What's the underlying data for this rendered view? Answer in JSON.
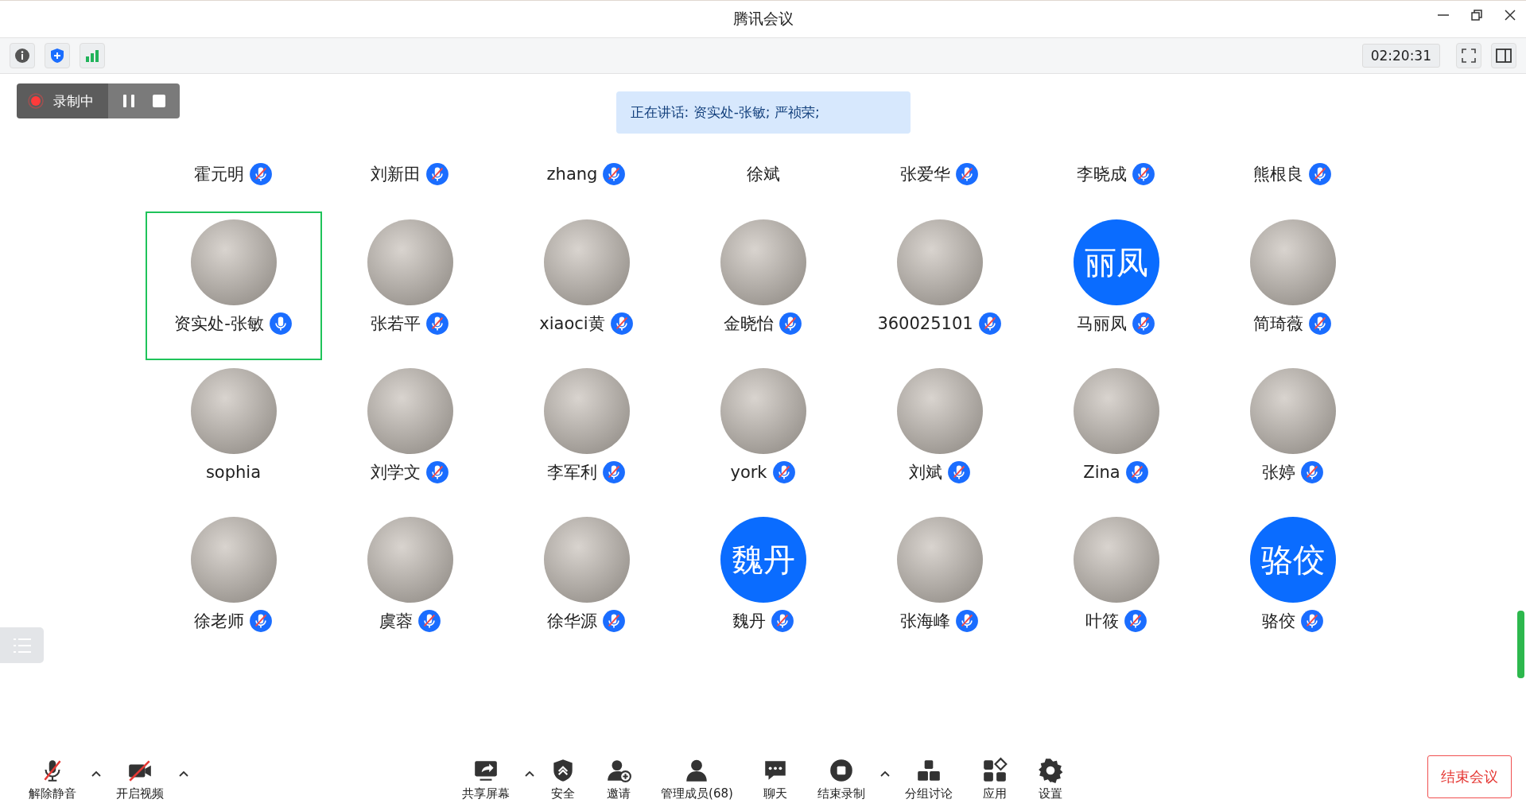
{
  "window": {
    "title": "腾讯会议"
  },
  "toolbar": {
    "timer": "02:20:31"
  },
  "recording": {
    "label": "录制中"
  },
  "speaking_banner": "正在讲话: 资实处-张敏; 严祯荣;",
  "participants": [
    {
      "name": "霍元明",
      "mic_icon": true,
      "muted": true,
      "selected": false
    },
    {
      "name": "刘新田",
      "mic_icon": true,
      "muted": true,
      "selected": false
    },
    {
      "name": "zhang",
      "mic_icon": true,
      "muted": true,
      "selected": false
    },
    {
      "name": "徐斌",
      "mic_icon": false,
      "selected": false
    },
    {
      "name": "张爱华",
      "mic_icon": true,
      "muted": true,
      "selected": false
    },
    {
      "name": "李晓成",
      "mic_icon": true,
      "muted": true,
      "selected": false
    },
    {
      "name": "熊根良",
      "mic_icon": true,
      "muted": true,
      "selected": false
    },
    {
      "name": "资实处-张敏",
      "mic_icon": true,
      "muted": false,
      "selected": true,
      "avatar": {
        "kind": "photo"
      }
    },
    {
      "name": "张若平",
      "mic_icon": true,
      "muted": true,
      "selected": false,
      "avatar": {
        "kind": "photo"
      }
    },
    {
      "name": "xiaoci黄",
      "mic_icon": true,
      "muted": true,
      "selected": false,
      "avatar": {
        "kind": "photo"
      }
    },
    {
      "name": "金晓怡",
      "mic_icon": true,
      "muted": true,
      "selected": false,
      "avatar": {
        "kind": "photo"
      }
    },
    {
      "name": "360025101",
      "mic_icon": true,
      "muted": true,
      "selected": false,
      "avatar": {
        "kind": "photo"
      }
    },
    {
      "name": "马丽凤",
      "mic_icon": true,
      "muted": true,
      "selected": false,
      "avatar": {
        "kind": "initials",
        "text": "丽凤"
      }
    },
    {
      "name": "简琦薇",
      "mic_icon": true,
      "muted": true,
      "selected": false,
      "avatar": {
        "kind": "photo"
      }
    },
    {
      "name": "sophia",
      "mic_icon": false,
      "selected": false,
      "avatar": {
        "kind": "photo"
      }
    },
    {
      "name": "刘学文",
      "mic_icon": true,
      "muted": true,
      "selected": false,
      "avatar": {
        "kind": "photo"
      }
    },
    {
      "name": "李军利",
      "mic_icon": true,
      "muted": true,
      "selected": false,
      "avatar": {
        "kind": "photo"
      }
    },
    {
      "name": "york",
      "mic_icon": true,
      "muted": true,
      "selected": false,
      "avatar": {
        "kind": "photo"
      }
    },
    {
      "name": "刘斌",
      "mic_icon": true,
      "muted": true,
      "selected": false,
      "avatar": {
        "kind": "photo"
      }
    },
    {
      "name": "Zina",
      "mic_icon": true,
      "muted": true,
      "selected": false,
      "avatar": {
        "kind": "photo"
      }
    },
    {
      "name": "张婷",
      "mic_icon": true,
      "muted": true,
      "selected": false,
      "avatar": {
        "kind": "photo"
      }
    },
    {
      "name": "徐老师",
      "mic_icon": true,
      "muted": true,
      "selected": false,
      "avatar": {
        "kind": "photo"
      }
    },
    {
      "name": "虞蓉",
      "mic_icon": true,
      "muted": true,
      "selected": false,
      "avatar": {
        "kind": "photo"
      }
    },
    {
      "name": "徐华源",
      "mic_icon": true,
      "muted": true,
      "selected": false,
      "avatar": {
        "kind": "photo"
      }
    },
    {
      "name": "魏丹",
      "mic_icon": true,
      "muted": true,
      "selected": false,
      "avatar": {
        "kind": "initials",
        "text": "魏丹"
      }
    },
    {
      "name": "张海峰",
      "mic_icon": true,
      "muted": true,
      "selected": false,
      "avatar": {
        "kind": "photo"
      }
    },
    {
      "name": "叶筱",
      "mic_icon": true,
      "muted": true,
      "selected": false,
      "avatar": {
        "kind": "photo"
      }
    },
    {
      "name": "骆佼",
      "mic_icon": true,
      "muted": true,
      "selected": false,
      "avatar": {
        "kind": "initials",
        "text": "骆佼"
      }
    }
  ],
  "controls_left": [
    {
      "label": "解除静音",
      "caret": true
    },
    {
      "label": "开启视频",
      "caret": true
    }
  ],
  "controls_center": [
    {
      "label": "共享屏幕",
      "caret": true
    },
    {
      "label": "安全",
      "caret": false
    },
    {
      "label": "邀请",
      "caret": false
    },
    {
      "label": "管理成员(68)",
      "caret": false
    },
    {
      "label": "聊天",
      "caret": false
    },
    {
      "label": "结束录制",
      "caret": true
    },
    {
      "label": "分组讨论",
      "caret": false
    },
    {
      "label": "应用",
      "caret": false
    },
    {
      "label": "设置",
      "caret": false
    }
  ],
  "end_button": "结束会议"
}
